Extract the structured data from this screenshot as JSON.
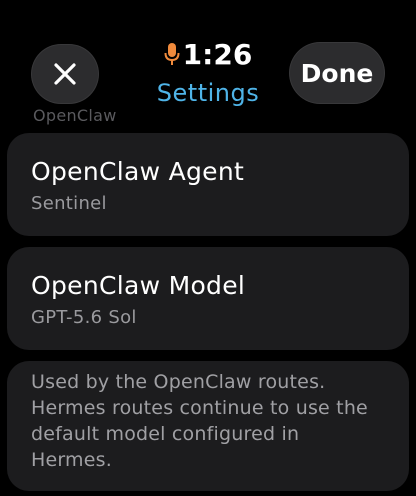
{
  "status": {
    "time": "1:26",
    "mic_icon": "microphone-icon",
    "mic_color": "#f08a3c"
  },
  "nav": {
    "title": "Settings",
    "title_color": "#4fb4e8",
    "close_icon": "close-icon",
    "done_label": "Done"
  },
  "section": {
    "header": "OpenClaw"
  },
  "rows": [
    {
      "label": "OpenClaw Agent",
      "value": "Sentinel"
    },
    {
      "label": "OpenClaw Model",
      "value": "GPT-5.6 Sol"
    }
  ],
  "footer": {
    "text": "Used by the OpenClaw routes. Hermes routes continue to use the default model configured in Hermes."
  }
}
